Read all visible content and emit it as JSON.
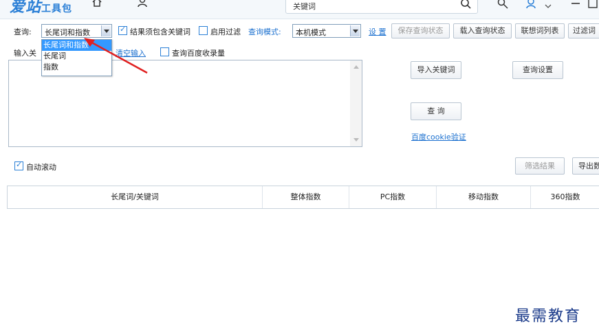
{
  "titlebar": {
    "logo_main": "爱站",
    "logo_sub": "工具包",
    "search_placeholder": "关键词"
  },
  "toolbar": {
    "query_label": "查询:",
    "query_type_value": "长尾词和指数",
    "must_contain_label": "结果须包含关键词",
    "must_contain_checked": true,
    "enable_filter_label": "启用过滤",
    "enable_filter_checked": false,
    "query_mode_label": "查询模式:",
    "query_mode_value": "本机模式",
    "settings_link": "设 置",
    "save_state_button": "保存查询状态",
    "load_state_button": "载入查询状态",
    "related_words_button": "联想词列表",
    "filter_words_button": "过滤词"
  },
  "dropdown": {
    "options": [
      "长尾词和指数",
      "长尾词",
      "指数"
    ],
    "selected_index": 0
  },
  "input_section": {
    "input_label": "输入关",
    "clear_input_link": "清空输入",
    "baidu_index_label": "查询百度收录量",
    "baidu_index_checked": false
  },
  "actions": {
    "import_keywords_button": "导入关键词",
    "query_settings_button": "查询设置",
    "query_button": "查 询",
    "baidu_cookie_link": "百度cookie验证"
  },
  "results": {
    "auto_scroll_label": "自动滚动",
    "auto_scroll_checked": true,
    "filter_results_button": "筛选结果",
    "export_button": "导出数",
    "columns": [
      "长尾词/关键词",
      "整体指数",
      "PC指数",
      "移动指数",
      "360指数"
    ]
  },
  "watermark": "最需教育",
  "colors": {
    "accent": "#2a7fd6",
    "link": "#1a6fcf",
    "selection": "#3399ff",
    "arrow": "#e02020"
  }
}
